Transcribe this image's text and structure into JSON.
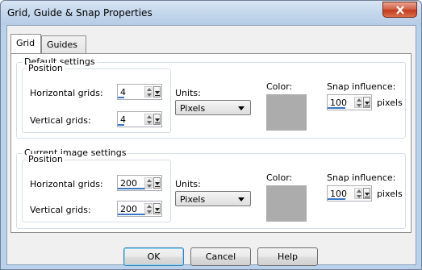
{
  "window": {
    "title": "Grid, Guide & Snap Properties",
    "close_label": "X"
  },
  "tabs": [
    {
      "label": "Grid",
      "active": true
    },
    {
      "label": "Guides",
      "active": false
    }
  ],
  "default_settings": {
    "legend": "Default settings",
    "position_legend": "Position",
    "horizontal_label": "Horizontal grids:",
    "horizontal_value": "4",
    "vertical_label": "Vertical grids:",
    "vertical_value": "4",
    "units_label": "Units:",
    "units_value": "Pixels",
    "color_label": "Color:",
    "color": "#acacac",
    "snap_label": "Snap influence:",
    "snap_value": "100",
    "snap_unit": "pixels"
  },
  "current_settings": {
    "legend": "Current image settings",
    "position_legend": "Position",
    "horizontal_label": "Horizontal grids:",
    "horizontal_value": "200",
    "vertical_label": "Vertical grids:",
    "vertical_value": "200",
    "units_label": "Units:",
    "units_value": "Pixels",
    "color_label": "Color:",
    "color": "#acacac",
    "snap_label": "Snap influence:",
    "snap_value": "100",
    "snap_unit": "pixels"
  },
  "buttons": {
    "ok": "OK",
    "cancel": "Cancel",
    "help": "Help"
  },
  "colors": {
    "accent": "#3a76c2",
    "frame": "#b9d1ea"
  }
}
